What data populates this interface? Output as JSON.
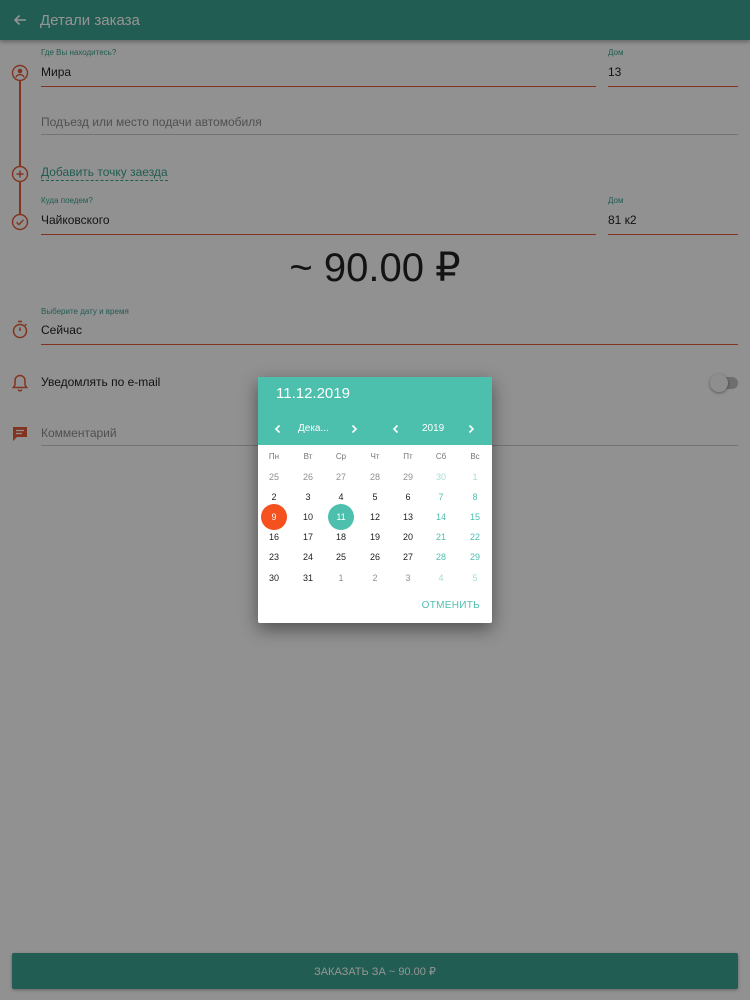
{
  "appbar": {
    "title": "Детали заказа",
    "back_icon": "arrow-back-icon"
  },
  "from": {
    "label": "Где Вы находитесь?",
    "value": "Мира",
    "house_label": "Дом",
    "house_value": "13"
  },
  "entrance": {
    "placeholder": "Подъезд или место подачи автомобиля"
  },
  "add_stop": {
    "label": "Добавить точку заезда"
  },
  "to": {
    "label": "Куда поедем?",
    "value": "Чайковского",
    "house_label": "Дом",
    "house_value": "81 к2"
  },
  "price": "~ 90.00 ₽",
  "datetime": {
    "label": "Выберите дату и время",
    "value": "Сейчас"
  },
  "notify": {
    "label": "Уведомлять по e-mail",
    "enabled": false
  },
  "comment": {
    "placeholder": "Комментарий"
  },
  "order_button": {
    "label": "ЗАКАЗАТЬ ЗА ~ 90.00 ₽"
  },
  "colors": {
    "accent": "#3aa08d",
    "picker_header": "#4dbfad",
    "route": "#e05a3a",
    "today": "#f4511e"
  },
  "date_picker": {
    "selected_date": "11.12.2019",
    "month": "Дека...",
    "year": "2019",
    "weekdays": [
      "Пн",
      "Вт",
      "Ср",
      "Чт",
      "Пт",
      "Сб",
      "Вс"
    ],
    "weeks": [
      [
        "25",
        "26",
        "27",
        "28",
        "29",
        "30",
        "1"
      ],
      [
        "2",
        "3",
        "4",
        "5",
        "6",
        "7",
        "8"
      ],
      [
        "9",
        "10",
        "11",
        "12",
        "13",
        "14",
        "15"
      ],
      [
        "16",
        "17",
        "18",
        "19",
        "20",
        "21",
        "22"
      ],
      [
        "23",
        "24",
        "25",
        "26",
        "27",
        "28",
        "29"
      ],
      [
        "30",
        "31",
        "1",
        "2",
        "3",
        "4",
        "5"
      ]
    ],
    "today": "9",
    "selected": "11",
    "cancel_label": "ОТМЕНИТЬ"
  }
}
